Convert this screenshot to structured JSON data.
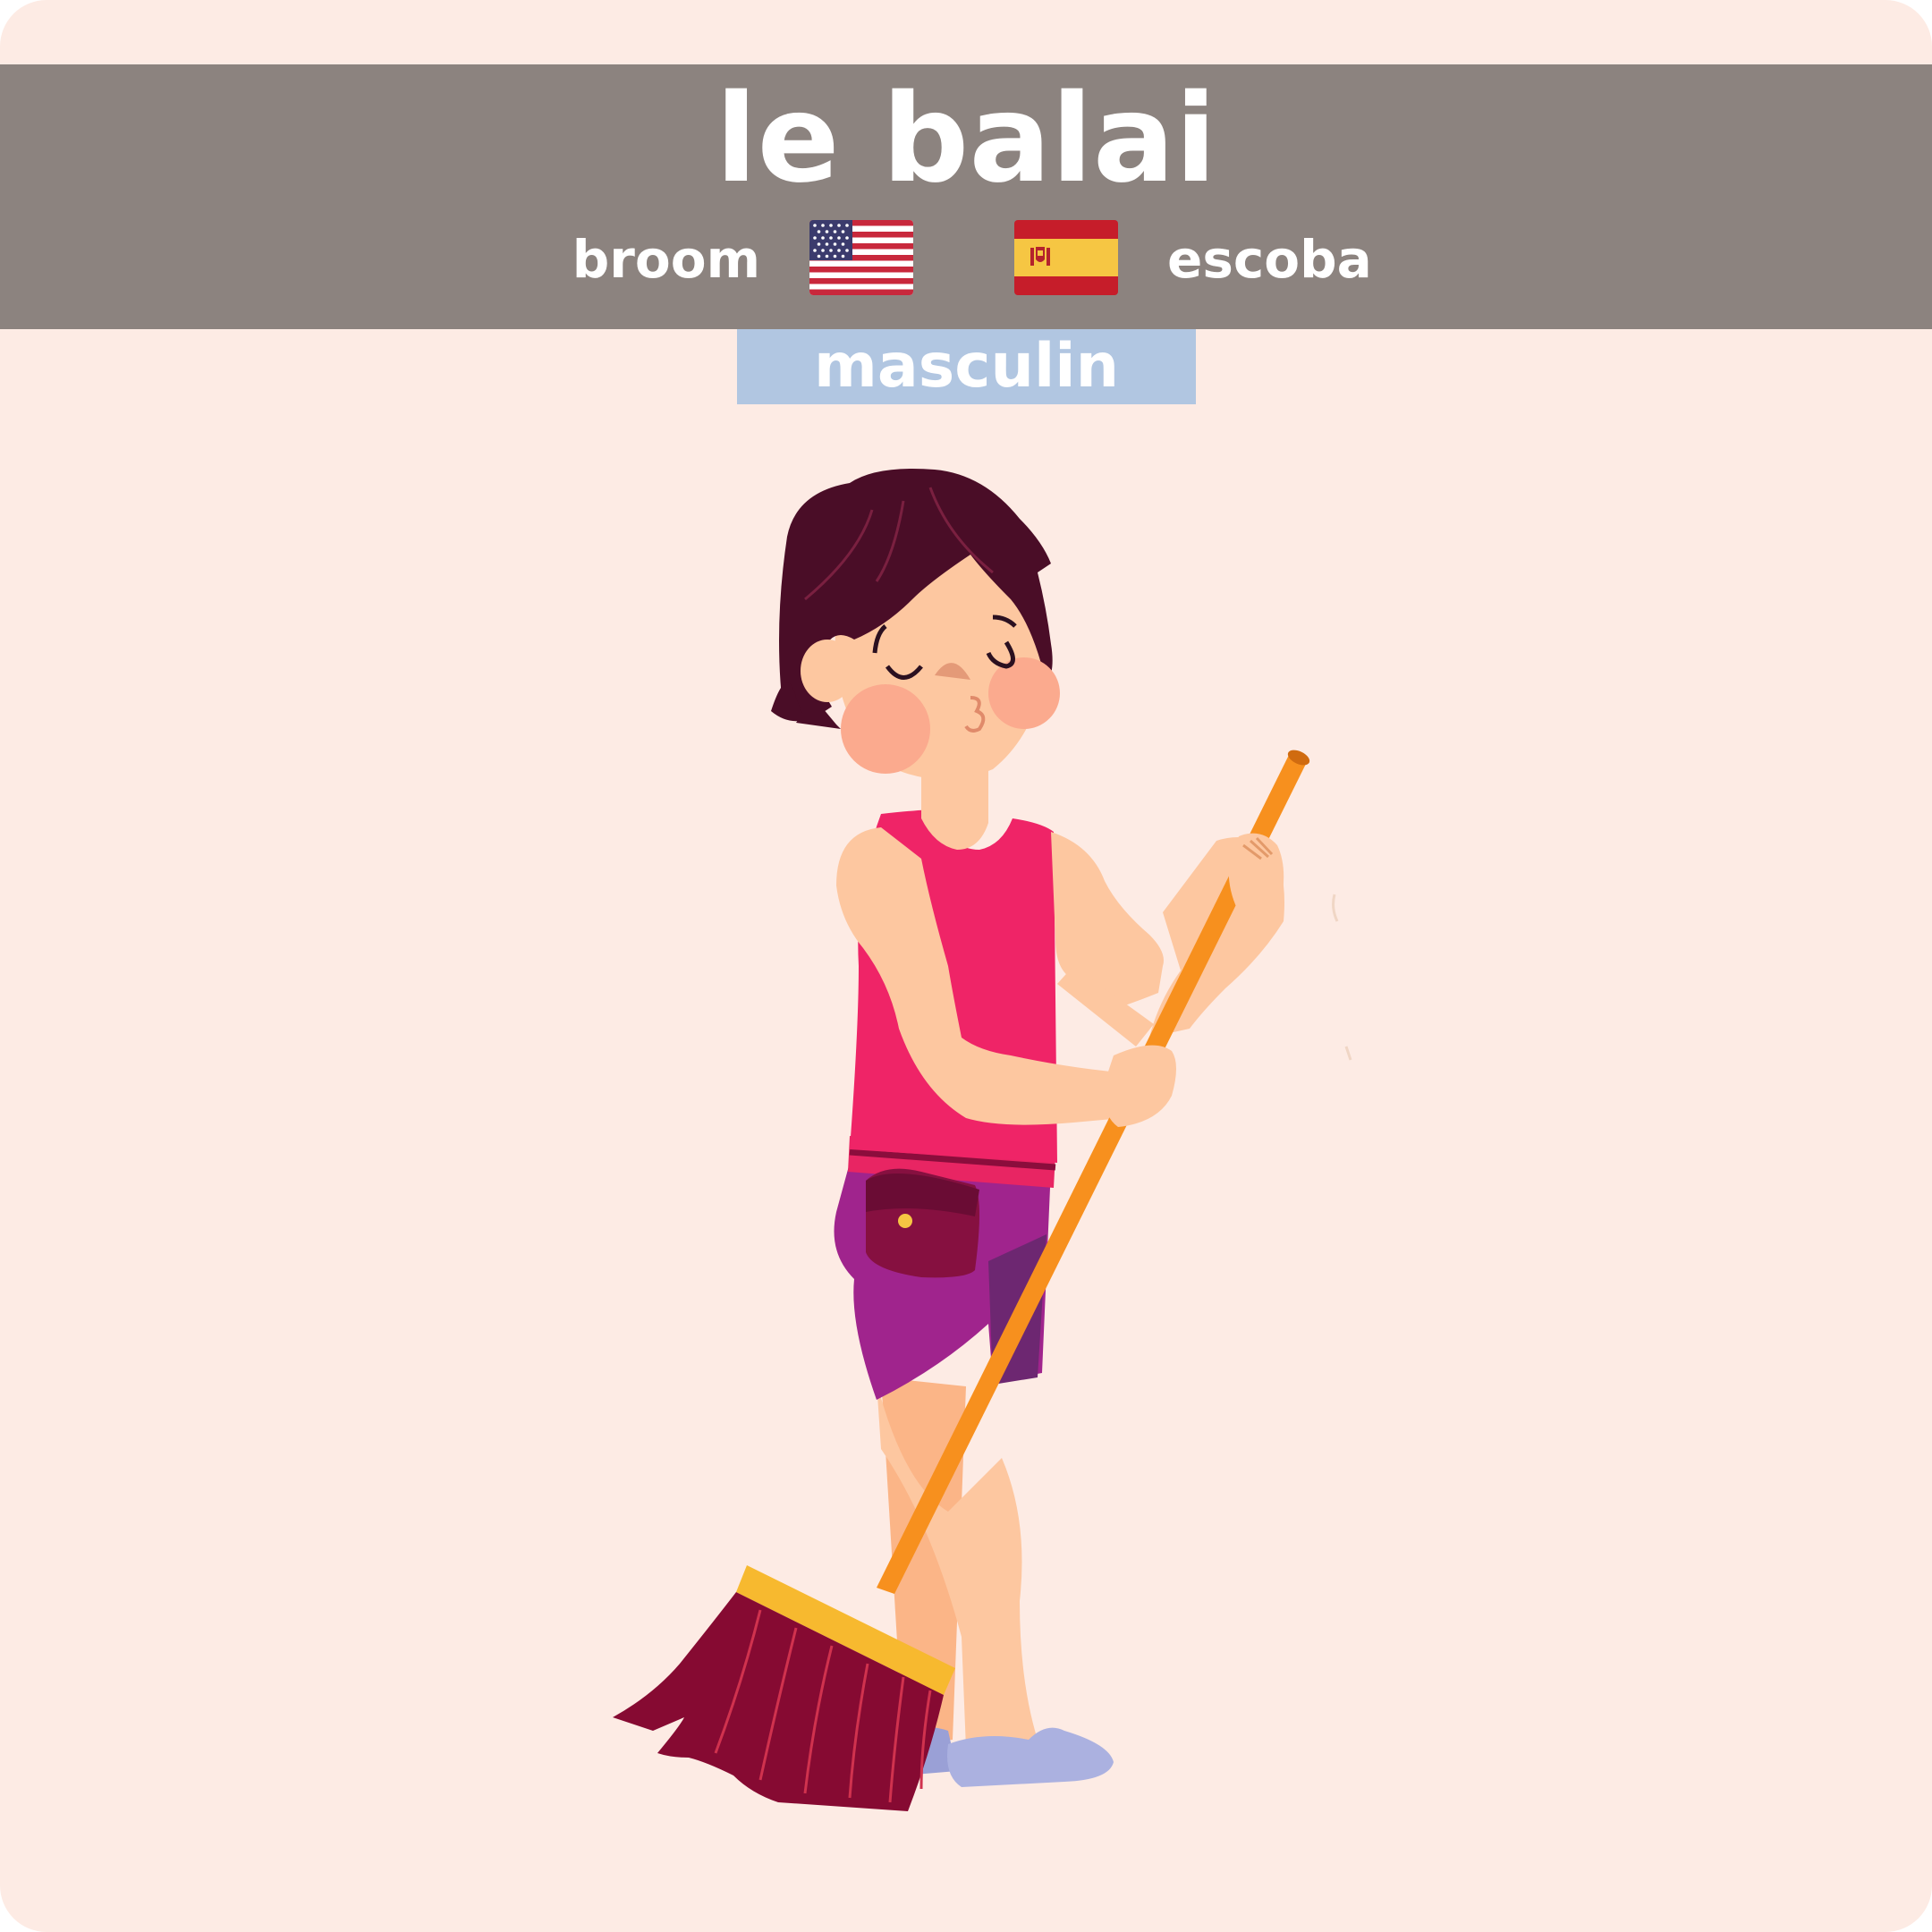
{
  "card": {
    "background": "#fdebe4",
    "header_color": "#8c837f",
    "gender_color": "#b1c6e1"
  },
  "word": {
    "french": "le balai",
    "english": "broom",
    "spanish": "escoba",
    "gender": "masculin"
  },
  "flags": {
    "english": "us-flag-icon",
    "spanish": "spain-flag-icon"
  },
  "illustration": "person-sweeping-with-broom"
}
